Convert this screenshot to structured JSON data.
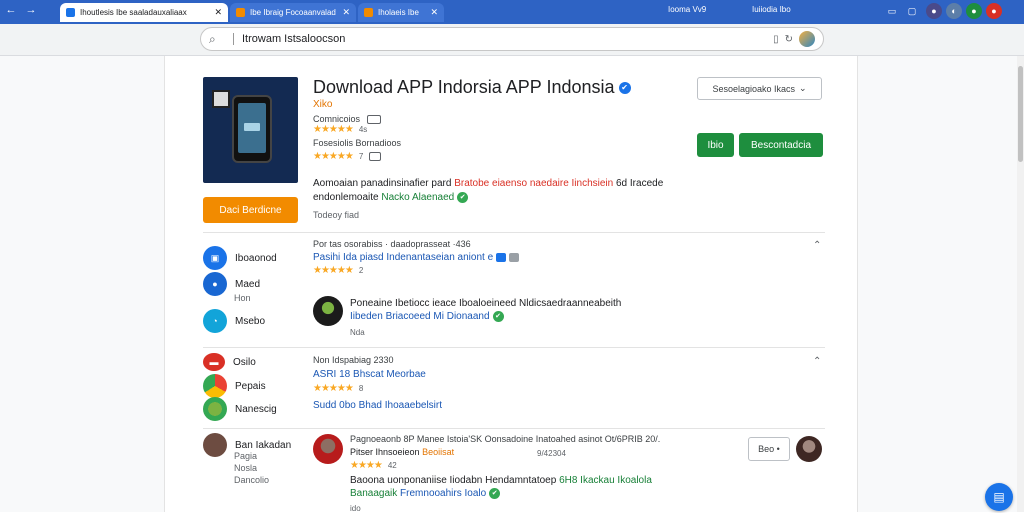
{
  "browser": {
    "nav_back": "←",
    "nav_forward": "→",
    "tabs": [
      {
        "label": "Ihoutlesis Ibe saaladauxaliaax",
        "close": "✕",
        "favicon_color": "#1a73e8"
      },
      {
        "label": "Ibe Ibraig Focoaanvalad",
        "close": "✕",
        "favicon_color": "#f28b00"
      },
      {
        "label": "Iholaeis Ibe",
        "close": "✕",
        "favicon_color": "#f28b00"
      }
    ],
    "tabbar_text_1": "Iooma Vv9",
    "tabbar_text_2": "Iuiiodia Ibo",
    "address": {
      "url": "Itrowam Istsaloocson",
      "search_icon": "search-icon",
      "tab_icon": "▯",
      "reload_icon": "↻"
    }
  },
  "app": {
    "title": "Download APP Indorsia APP Indonsia",
    "verified_mark": "✔",
    "developer": "Xiko",
    "meta_1": "Comnicoios",
    "rating_1": "★★★★★",
    "rating_1_count": "4s",
    "meta_2": "Fosesiolis Bornadioos",
    "rating_2": "★★★★★",
    "rating_2_count": "7",
    "select_label": "Sesoelagioako Ikacs",
    "select_chevron": "⌄",
    "install_short": "Ibio",
    "install_long": "Bescontadcia",
    "orange_button": "Daci Berdicne",
    "desc_line_1_start": "Aomoaian panadinsinafier pard",
    "desc_line_1_red": "Bratobe eiaenso naedaire Iinchsiein",
    "desc_line_1_end": "6d Iracede",
    "desc_line_2_start": "endonlemoaite",
    "desc_line_2_green": "Nacko Alaenaed",
    "desc_line_3": "Todeoy fiad"
  },
  "sidebar_group_1": [
    {
      "label": "Iboaonod",
      "sub": "",
      "icon": "app-icon",
      "color": "#1a73e8"
    },
    {
      "label": "Maed",
      "sub": "Hon",
      "icon": "user-icon",
      "color": "#1967d2"
    },
    {
      "label": "Msebo",
      "sub": "",
      "icon": "chart-icon",
      "color": "#12a4d9"
    }
  ],
  "sidebar_group_2": [
    {
      "label": "Osilo",
      "icon": "app-icon",
      "color": "#d93025"
    },
    {
      "label": "Pepais",
      "icon": "chrome-icon",
      "color": "#4285f4"
    },
    {
      "label": "Nanescig",
      "icon": "globe-icon",
      "color": "#34a853"
    }
  ],
  "sidebar_group_3": {
    "label": "Ban Iakadan",
    "subs": [
      "Pagia",
      "Nosla",
      "Dancolio"
    ]
  },
  "reviews": {
    "section_1_head": "Por tas osorabiss · daadoprasseat ·436",
    "section_1_link": "Pasihi Ida piasd Indenantaseian aniont e",
    "section_1_stars": "★★★★★",
    "section_1_count": "2",
    "chevron_up": "⌃",
    "review_1_line_1": "Poneaine Ibetiocc ieace Iboaloeineed Nldicsaedraanneabeith",
    "review_1_line_2": "Iibeden Briacoeed Mi Dionaand",
    "review_1_small": "Nda",
    "section_2_head": "Non Idspabiag 2330",
    "section_2_link": "ASRI 18 Bhscat Meorbae",
    "section_2_stars": "★★★★★",
    "section_2_count": "8",
    "section_2_line": "Sudd 0bo Bhad Ihoaaebelsirt",
    "review_2_line_1": "Pagnoeaonb 8P Manee Istoia'SK Oonsadoine Inatoahed asinot Ot/6PRIB 20/.",
    "review_2_line_2_start": "Pitser Ihnsoeieon",
    "review_2_line_2_orange": "Beoiisat",
    "review_2_date": "9/42304",
    "review_2_stars": "★★★★",
    "review_2_count": "42",
    "review_2_line_3_start": "Baoona uonponaniise Iiodabn Hendamntatoep",
    "review_2_line_3_green": "6H8 Ikackau Ikoalola",
    "review_2_line_4_green": "Banaagaik",
    "review_2_line_4_mid": "Fremnooahirs Ioalo",
    "review_2_small": "ido",
    "more_label": "Beo"
  },
  "fab_icon": "chat-icon",
  "colors": {
    "tabbar": "#2e63c4",
    "accent_green": "#1e8e3e",
    "accent_orange": "#f28b00",
    "link_blue": "#1a57b4"
  }
}
